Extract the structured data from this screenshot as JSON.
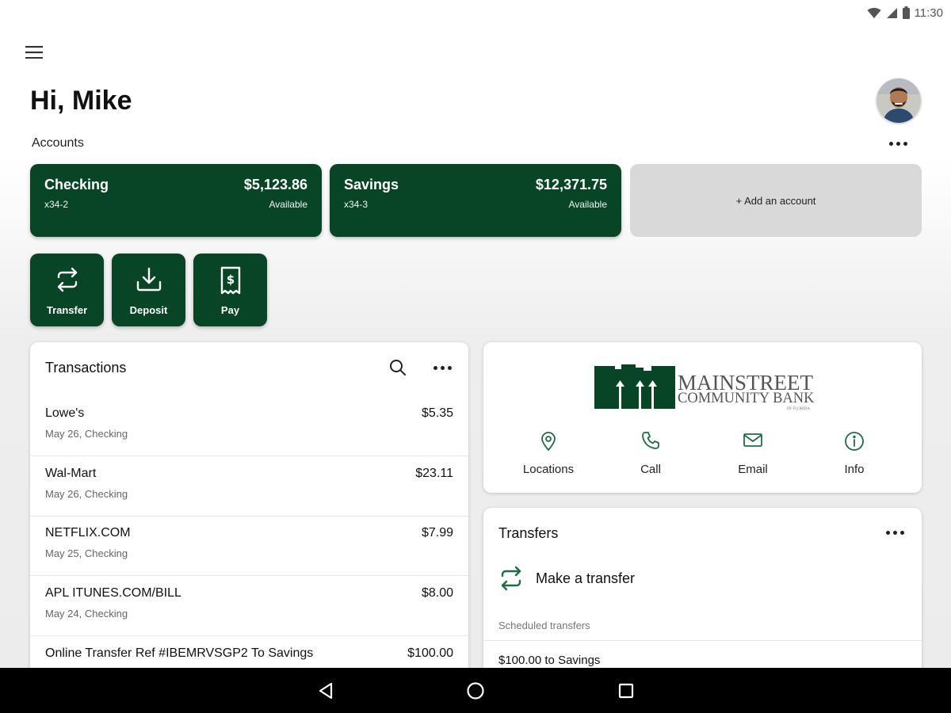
{
  "status_bar": {
    "time": "11:30"
  },
  "header": {
    "greeting": "Hi, Mike"
  },
  "accounts": {
    "label": "Accounts",
    "cards": [
      {
        "name": "Checking",
        "number": "x34-2",
        "balance": "$5,123.86",
        "balance_label": "Available"
      },
      {
        "name": "Savings",
        "number": "x34-3",
        "balance": "$12,371.75",
        "balance_label": "Available"
      }
    ],
    "add_label": "+ Add an account"
  },
  "actions": [
    {
      "label": "Transfer",
      "icon": "transfer-icon"
    },
    {
      "label": "Deposit",
      "icon": "deposit-icon"
    },
    {
      "label": "Pay",
      "icon": "pay-icon"
    }
  ],
  "transactions": {
    "title": "Transactions",
    "rows": [
      {
        "merchant": "Lowe's",
        "meta": "May 26, Checking",
        "amount": "$5.35"
      },
      {
        "merchant": "Wal-Mart",
        "meta": "May 26, Checking",
        "amount": "$23.11"
      },
      {
        "merchant": "NETFLIX.COM",
        "meta": "May 25, Checking",
        "amount": "$7.99"
      },
      {
        "merchant": "APL ITUNES.COM/BILL",
        "meta": "May 24, Checking",
        "amount": "$8.00"
      },
      {
        "merchant": "Online Transfer Ref #IBEMRVSGP2 To Savings",
        "meta": "",
        "amount": "$100.00"
      }
    ]
  },
  "bank": {
    "logo_line1": "MAINSTREET",
    "logo_line2": "COMMUNITY BANK",
    "logo_line3": "OF FLORIDA",
    "contacts": [
      {
        "label": "Locations",
        "icon": "location-pin-icon"
      },
      {
        "label": "Call",
        "icon": "phone-icon"
      },
      {
        "label": "Email",
        "icon": "email-icon"
      },
      {
        "label": "Info",
        "icon": "info-icon"
      }
    ]
  },
  "transfers": {
    "title": "Transfers",
    "make_transfer": "Make a transfer",
    "scheduled_label": "Scheduled transfers",
    "scheduled": [
      "$100.00 to Savings"
    ]
  },
  "colors": {
    "brand_green": "#084426",
    "add_card_gray": "#d9d9d9"
  }
}
